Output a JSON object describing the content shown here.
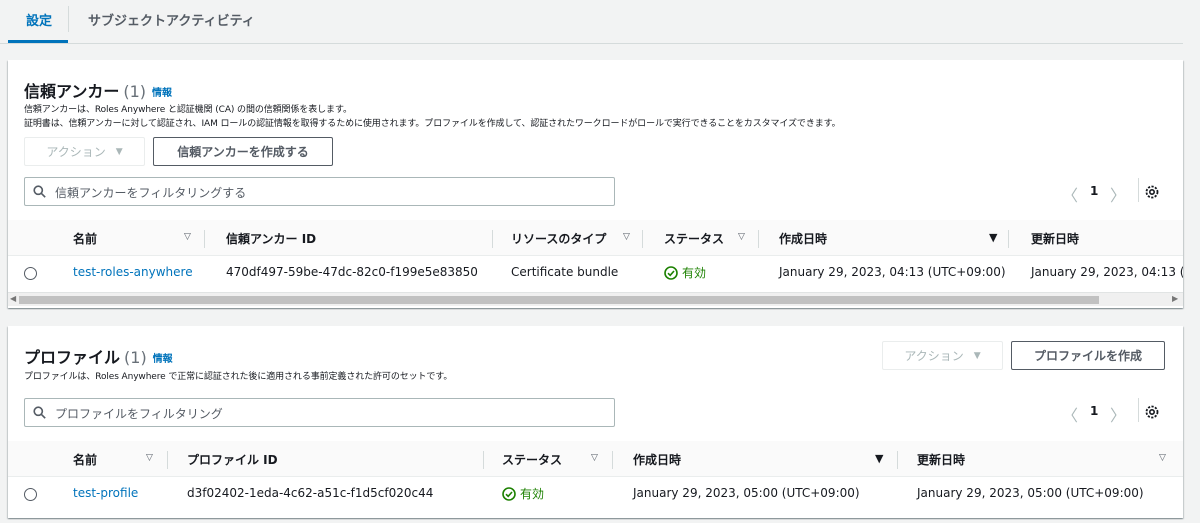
{
  "tabs": [
    {
      "label": "設定",
      "active": true
    },
    {
      "label": "サブジェクトアクティビティ",
      "active": false
    }
  ],
  "trust_anchors": {
    "title": "信頼アンカー",
    "count": "(1)",
    "info_label": "情報",
    "description_line1": "信頼アンカーは、Roles Anywhere と認証機関 (CA) の間の信頼関係を表します。",
    "description_line2": "証明書は、信頼アンカーに対して認証され、IAM ロールの認証情報を取得するために使用されます。プロファイルを作成して、認証されたワークロードがロールで実行できることをカスタマイズできます。",
    "actions_label": "アクション",
    "create_label": "信頼アンカーを作成する",
    "search_placeholder": "信頼アンカーをフィルタリングする",
    "page": "1",
    "columns": [
      "名前",
      "信頼アンカー ID",
      "リソースのタイプ",
      "ステータス",
      "作成日時",
      "更新日時"
    ],
    "rows": [
      {
        "name": "test-roles-anywhere",
        "id": "470df497-59be-47dc-82c0-f199e5e83850",
        "type": "Certificate bundle",
        "status": "有効",
        "created": "January 29, 2023, 04:13 (UTC+09:00)",
        "updated": "January 29, 2023, 04:13 (U"
      }
    ]
  },
  "profiles": {
    "title": "プロファイル",
    "count": "(1)",
    "info_label": "情報",
    "description": "プロファイルは、Roles Anywhere で正常に認証された後に適用される事前定義された許可のセットです。",
    "actions_label": "アクション",
    "create_label": "プロファイルを作成",
    "search_placeholder": "プロファイルをフィルタリング",
    "page": "1",
    "columns": [
      "名前",
      "プロファイル ID",
      "ステータス",
      "作成日時",
      "更新日時"
    ],
    "rows": [
      {
        "name": "test-profile",
        "id": "d3f02402-1eda-4c62-a51c-f1d5cf020c44",
        "status": "有効",
        "created": "January 29, 2023, 05:00 (UTC+09:00)",
        "updated": "January 29, 2023, 05:00 (UTC+09:00)"
      }
    ]
  },
  "colors": {
    "link": "#0073bb",
    "success": "#1d8102",
    "text": "#16191f"
  },
  "icons": [
    "search-icon",
    "gear-icon",
    "chevron-left-icon",
    "chevron-right-icon",
    "sort-icon",
    "sort-desc-icon",
    "status-ok-icon",
    "caret-down-icon"
  ]
}
